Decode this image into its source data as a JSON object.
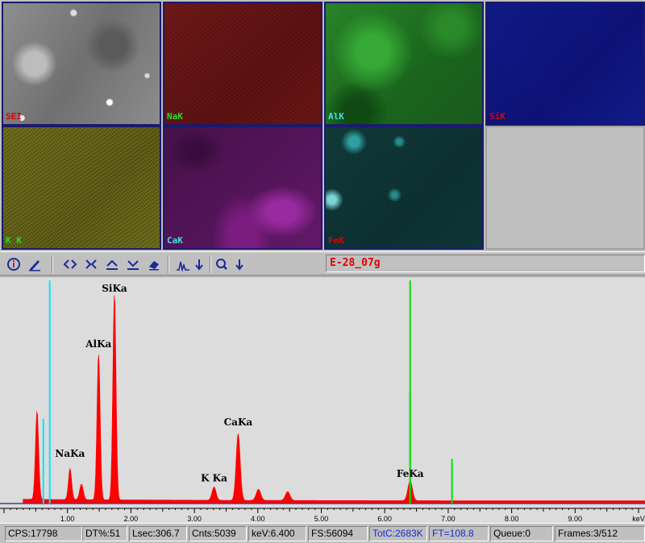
{
  "maps": [
    {
      "label": "SEI",
      "label_color": "#e00000"
    },
    {
      "label": "NaK",
      "label_color": "#20e020"
    },
    {
      "label": "AlK",
      "label_color": "#40e0e0"
    },
    {
      "label": "SiK",
      "label_color": "#e00000"
    },
    {
      "label": "K K",
      "label_color": "#20e020"
    },
    {
      "label": "CaK",
      "label_color": "#40e0e0"
    },
    {
      "label": "FeK",
      "label_color": "#e00000"
    }
  ],
  "toolbar": {
    "icons": [
      "info-icon",
      "pen-icon",
      "expand-horizontal-icon",
      "compress-horizontal-icon",
      "expand-vertical-icon",
      "compress-vertical-icon",
      "eraser-icon",
      "peak-icon",
      "down-arrow-icon",
      "magnify-icon",
      "down-arrow-icon"
    ],
    "spectrum_name": "E-28_07g"
  },
  "chart_data": {
    "type": "line",
    "xlabel": "keV",
    "xlim": [
      0,
      10
    ],
    "x_ticks": [
      "1.00",
      "2.00",
      "3.00",
      "4.00",
      "5.00",
      "6.00",
      "7.00",
      "8.00",
      "9.00",
      "keV"
    ],
    "x_tick_values": [
      1,
      2,
      3,
      4,
      5,
      6,
      7,
      8,
      9,
      10
    ],
    "series": [
      {
        "color": "#ff0000",
        "peaks": [
          {
            "kev": 0.52,
            "height": 0.4,
            "width": 0.035
          },
          {
            "kev": 1.04,
            "height": 0.14,
            "width": 0.035
          },
          {
            "kev": 1.22,
            "height": 0.07,
            "width": 0.04
          },
          {
            "kev": 1.49,
            "height": 0.66,
            "width": 0.035
          },
          {
            "kev": 1.74,
            "height": 0.93,
            "width": 0.035
          },
          {
            "kev": 3.31,
            "height": 0.06,
            "width": 0.045
          },
          {
            "kev": 3.69,
            "height": 0.3,
            "width": 0.045
          },
          {
            "kev": 4.01,
            "height": 0.05,
            "width": 0.05
          },
          {
            "kev": 4.47,
            "height": 0.04,
            "width": 0.05
          },
          {
            "kev": 6.4,
            "height": 0.09,
            "width": 0.05
          }
        ]
      }
    ],
    "peak_labels": [
      {
        "text": "NaKa",
        "kev": 1.04,
        "height": 0.21
      },
      {
        "text": "AlKa",
        "kev": 1.49,
        "height": 0.7
      },
      {
        "text": "SiKa",
        "kev": 1.74,
        "height": 0.95
      },
      {
        "text": "K Ka",
        "kev": 3.31,
        "height": 0.1
      },
      {
        "text": "CaKa",
        "kev": 3.69,
        "height": 0.35
      },
      {
        "text": "FeKa",
        "kev": 6.4,
        "height": 0.12
      }
    ],
    "markers": [
      {
        "kev": 0.72,
        "height": 1.0,
        "color": "#00e8ff"
      },
      {
        "kev": 0.62,
        "height": 0.38,
        "color": "#00e8ff"
      },
      {
        "kev": 6.4,
        "height": 1.0,
        "color": "#00e000"
      },
      {
        "kev": 6.4,
        "height": 0.5,
        "color": "#00e000"
      },
      {
        "kev": 7.06,
        "height": 0.2,
        "color": "#00e000"
      }
    ]
  },
  "status": {
    "cps": "CPS:17798",
    "dt": "DT%:51",
    "lsec": "Lsec:306.7",
    "cnts": "Cnts:5039",
    "kev": "keV:6.400",
    "fs": "FS:56094",
    "totc": "TotC:2683K",
    "ft": "FT=108.8",
    "queue": "Queue:0",
    "frames": "Frames:3/512"
  }
}
